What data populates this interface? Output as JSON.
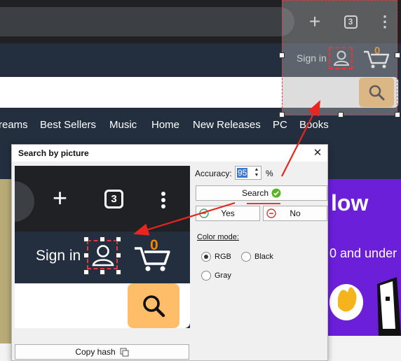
{
  "browser": {
    "tabs_count": "3",
    "new_tab_glyph": "+",
    "more_glyph": "⋮"
  },
  "site": {
    "signin_label": "Sign in",
    "cart_count": "0",
    "nav_items": [
      "reams",
      "Best Sellers",
      "Music",
      "Home",
      "New Releases",
      "PC",
      "Books"
    ],
    "banner_text_large": "low",
    "banner_text_small": "0 and under"
  },
  "dialog": {
    "title": "Search by picture",
    "close_glyph": "✕",
    "accuracy_label": "Accuracy:",
    "accuracy_value": "95",
    "percent_label": "%",
    "search_label": "Search",
    "yes_label": "Yes",
    "no_label": "No",
    "color_mode_label": "Color mode:",
    "color_modes": [
      "RGB",
      "Black",
      "Gray"
    ],
    "selected_color_mode": "RGB",
    "copy_hash_label": "Copy hash",
    "preview": {
      "signin_label": "Sign in",
      "cart_count": "0",
      "tabs_count": "3",
      "new_tab_glyph": "+"
    }
  },
  "colors": {
    "header_dark": "#232f3e",
    "toolbar_dark": "#202124",
    "search_button": "#febd69",
    "cart_count": "#f08804",
    "selection_border": "#e23a3a",
    "banner_purple": "#6b1fd9",
    "check_green": "#58b51f"
  },
  "icons": [
    "plus-icon",
    "tab-count-icon",
    "more-vert-icon",
    "user-icon",
    "cart-icon",
    "search-icon",
    "check-icon",
    "copy-icon",
    "close-icon",
    "yes-icon",
    "no-icon"
  ]
}
